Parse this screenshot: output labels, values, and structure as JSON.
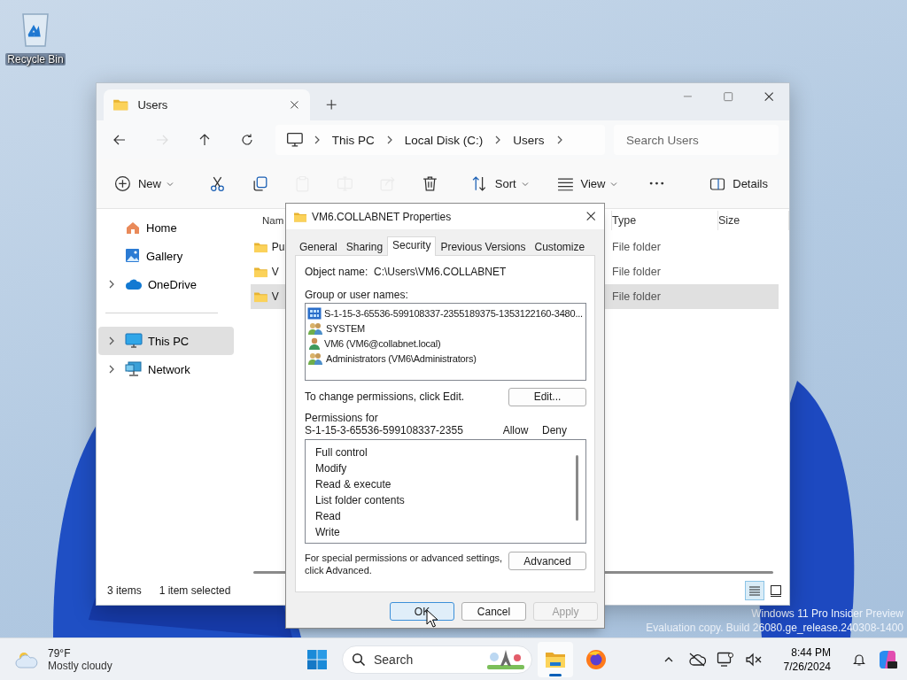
{
  "desktop": {
    "icons": [
      {
        "kind": "recycle-bin",
        "label": "Recycle Bin"
      }
    ],
    "watermark": [
      "Windows 11 Pro Insider Preview",
      "Evaluation copy. Build 26080.ge_release.240308-1400"
    ]
  },
  "explorer": {
    "tab": {
      "title": "Users"
    },
    "nav": [
      {
        "kind": "back",
        "disabled": false
      },
      {
        "kind": "forward",
        "disabled": true
      },
      {
        "kind": "up",
        "disabled": false
      },
      {
        "kind": "refresh",
        "disabled": false
      }
    ],
    "crumbs": [
      "This PC",
      "Local Disk (C:)",
      "Users"
    ],
    "search": {
      "placeholder": "Search Users"
    },
    "toolbar": [
      {
        "kind": "new",
        "label": "New",
        "disabled": false
      },
      {
        "kind": "cut",
        "disabled": false
      },
      {
        "kind": "copy",
        "disabled": false
      },
      {
        "kind": "paste",
        "disabled": true
      },
      {
        "kind": "rename",
        "disabled": true
      },
      {
        "kind": "share",
        "disabled": true
      },
      {
        "kind": "delete",
        "disabled": false
      },
      {
        "kind": "sort",
        "label": "Sort",
        "disabled": false
      },
      {
        "kind": "view",
        "label": "View",
        "disabled": false
      },
      {
        "kind": "more",
        "disabled": false
      }
    ],
    "details_button": "Details",
    "sidebar": {
      "groups": [
        [
          {
            "kind": "home",
            "label": "Home",
            "expandable": false,
            "selected": false
          },
          {
            "kind": "gallery",
            "label": "Gallery",
            "expandable": false,
            "selected": false
          },
          {
            "kind": "cloud",
            "label": "OneDrive",
            "expandable": true,
            "selected": false
          }
        ],
        [
          {
            "kind": "pc",
            "label": "This PC",
            "expandable": true,
            "selected": true
          },
          {
            "kind": "network",
            "label": "Network",
            "expandable": true,
            "selected": false
          }
        ]
      ]
    },
    "columns": [
      "Nam",
      "Type",
      "Size"
    ],
    "rows": [
      {
        "name": "Pu",
        "type": "File folder",
        "selected": false
      },
      {
        "name": "V",
        "type": "File folder",
        "selected": false
      },
      {
        "name": "V",
        "type": "File folder",
        "selected": true
      }
    ],
    "status_bar": [
      "3 items",
      "1 item selected"
    ],
    "view_buttons": [
      {
        "kind": "details",
        "selected": true
      },
      {
        "kind": "tiles",
        "selected": false
      }
    ]
  },
  "dialog": {
    "title": "VM6.COLLABNET Properties",
    "tabs": [
      {
        "label": "General",
        "selected": false
      },
      {
        "label": "Sharing",
        "selected": false
      },
      {
        "label": "Security",
        "selected": true
      },
      {
        "label": "Previous Versions",
        "selected": false
      },
      {
        "label": "Customize",
        "selected": false
      }
    ],
    "object_name_label": "Object name:",
    "object_name": "C:\\Users\\VM6.COLLABNET",
    "group_label": "Group or user names:",
    "principals": [
      {
        "kind": "app",
        "name": "S-1-15-3-65536-599108337-2355189375-1353122160-3480..."
      },
      {
        "kind": "group",
        "name": "SYSTEM"
      },
      {
        "kind": "user",
        "name": "VM6 (VM6@collabnet.local)"
      },
      {
        "kind": "group",
        "name": "Administrators (VM6\\Administrators)"
      }
    ],
    "change_hint": "To change permissions, click Edit.",
    "edit_button": "Edit...",
    "permissions_for_label": "Permissions for",
    "permissions_for_name": "S-1-15-3-65536-599108337-2355",
    "permission_columns": [
      "Allow",
      "Deny"
    ],
    "permissions": [
      "Full control",
      "Modify",
      "Read & execute",
      "List folder contents",
      "Read",
      "Write"
    ],
    "advanced_hint": [
      "For special permissions or advanced settings,",
      "click Advanced."
    ],
    "advanced_button": "Advanced",
    "buttons": [
      {
        "label": "OK",
        "default": true,
        "disabled": false
      },
      {
        "label": "Cancel",
        "default": false,
        "disabled": false
      },
      {
        "label": "Apply",
        "default": false,
        "disabled": true
      }
    ]
  },
  "taskbar": {
    "weather": {
      "temperature": "79°F",
      "condition": "Mostly cloudy"
    },
    "search": {
      "placeholder": "Search"
    },
    "apps": [
      {
        "kind": "file-explorer",
        "active": true
      },
      {
        "kind": "browser",
        "active": false
      }
    ],
    "time": "8:44 PM",
    "date": "7/26/2024"
  }
}
